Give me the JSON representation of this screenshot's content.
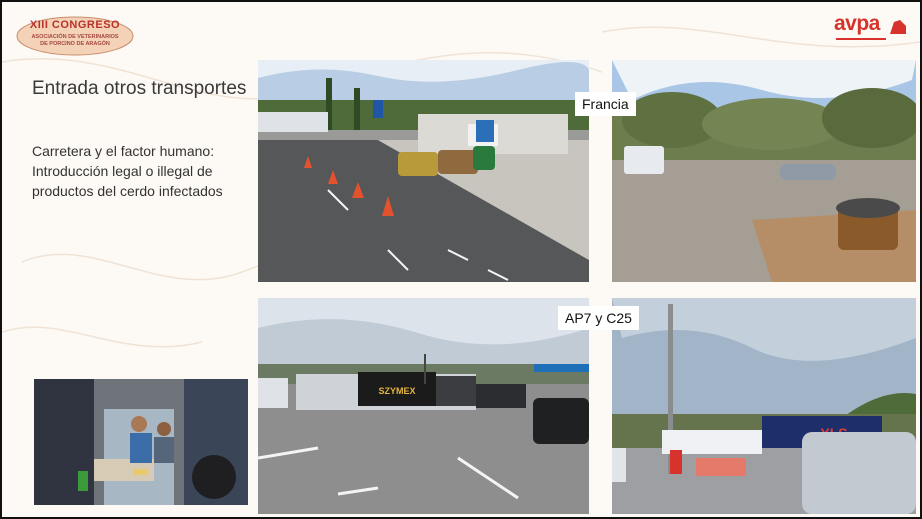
{
  "logo_left": {
    "line1": "XIII CONGRESO",
    "line2": "ASOCIACIÓN DE VETERINARIOS",
    "line3": "DE PORCINO DE ARAGÓN"
  },
  "logo_right": {
    "text": "avpa"
  },
  "title": "Entrada otros transportes",
  "subtitle": "Carretera y el factor humano: Introducción legal o illegal de productos del cerdo infectados",
  "labels": {
    "francia": "Francia",
    "ap7": "AP7 y C25"
  },
  "truck_text": "SZYMEX",
  "truck_text2": "YLS",
  "colors": {
    "brand_red": "#d8322c",
    "logo_red": "#b8322a",
    "background": "#fdf9f4"
  }
}
